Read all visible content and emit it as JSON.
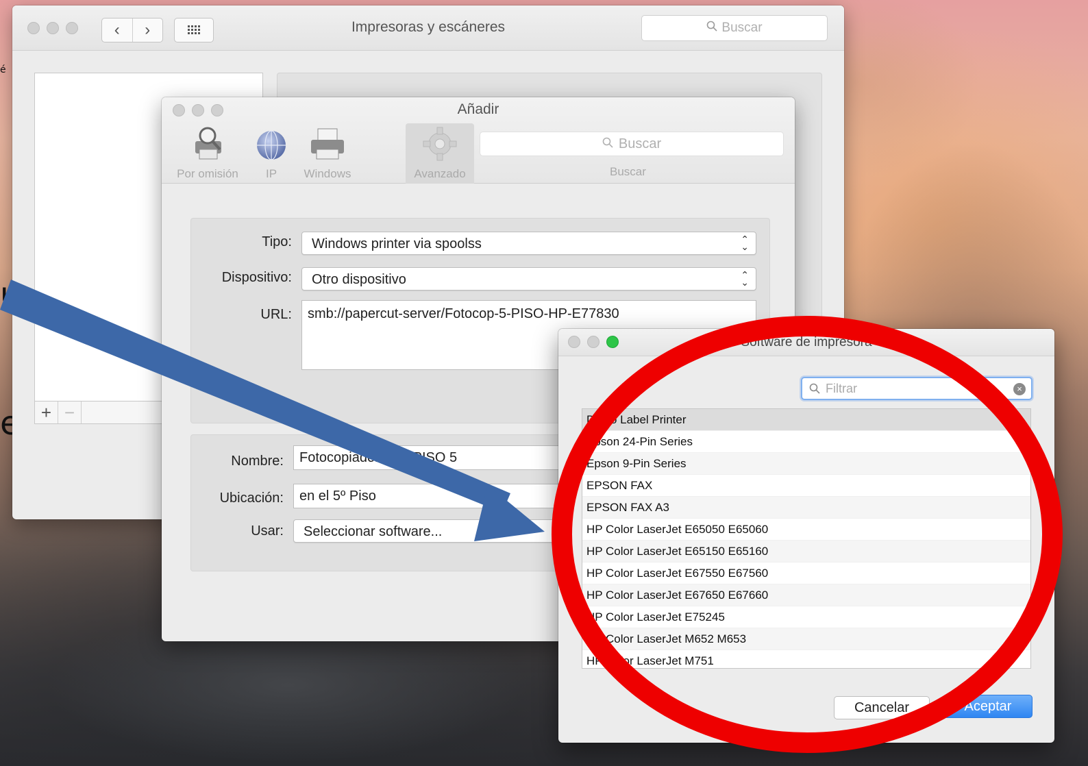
{
  "background": {
    "edge_glyphs": [
      "é",
      "u",
      "e"
    ]
  },
  "main_window": {
    "title": "Impresoras y escáneres",
    "search_placeholder": "Buscar",
    "add_symbol": "+",
    "remove_symbol": "−"
  },
  "add_dialog": {
    "title": "Añadir",
    "toolbar": [
      {
        "label": "Por omisión",
        "icon": "printer-magnifier-icon"
      },
      {
        "label": "IP",
        "icon": "globe-icon"
      },
      {
        "label": "Windows",
        "icon": "printer-icon"
      },
      {
        "label": "Avanzado",
        "icon": "gear-icon",
        "selected": true
      }
    ],
    "search_placeholder": "Buscar",
    "search_label": "Buscar",
    "fields": {
      "tipo_label": "Tipo:",
      "tipo_value": "Windows printer via spoolss",
      "dispositivo_label": "Dispositivo:",
      "dispositivo_value": "Otro dispositivo",
      "url_label": "URL:",
      "url_value": "smb://papercut-server/Fotocop-5-PISO-HP-E77830",
      "nombre_label": "Nombre:",
      "nombre_value": "Fotocopiadora del PISO 5",
      "ubicacion_label": "Ubicación:",
      "ubicacion_value": "en el 5º Piso",
      "usar_label": "Usar:",
      "usar_value": "Seleccionar software..."
    }
  },
  "software_dialog": {
    "title": "Software de impresora",
    "filter_placeholder": "Filtrar",
    "items": [
      "Dymo Label Printer",
      "Epson 24-Pin Series",
      "Epson 9-Pin Series",
      "EPSON FAX",
      "EPSON FAX A3",
      "HP Color LaserJet E65050 E65060",
      "HP Color LaserJet E65150 E65160",
      "HP Color LaserJet E67550 E67560",
      "HP Color LaserJet E67650 E67660",
      "HP Color LaserJet E75245",
      "HP Color LaserJet M652 M653",
      "HP Color LaserJet M751"
    ],
    "selected_index": 0,
    "cancel_label": "Cancelar",
    "ok_label": "Aceptar"
  },
  "annotations": {
    "arrow_color": "#3d68a8",
    "circle_color": "#ee0000"
  }
}
